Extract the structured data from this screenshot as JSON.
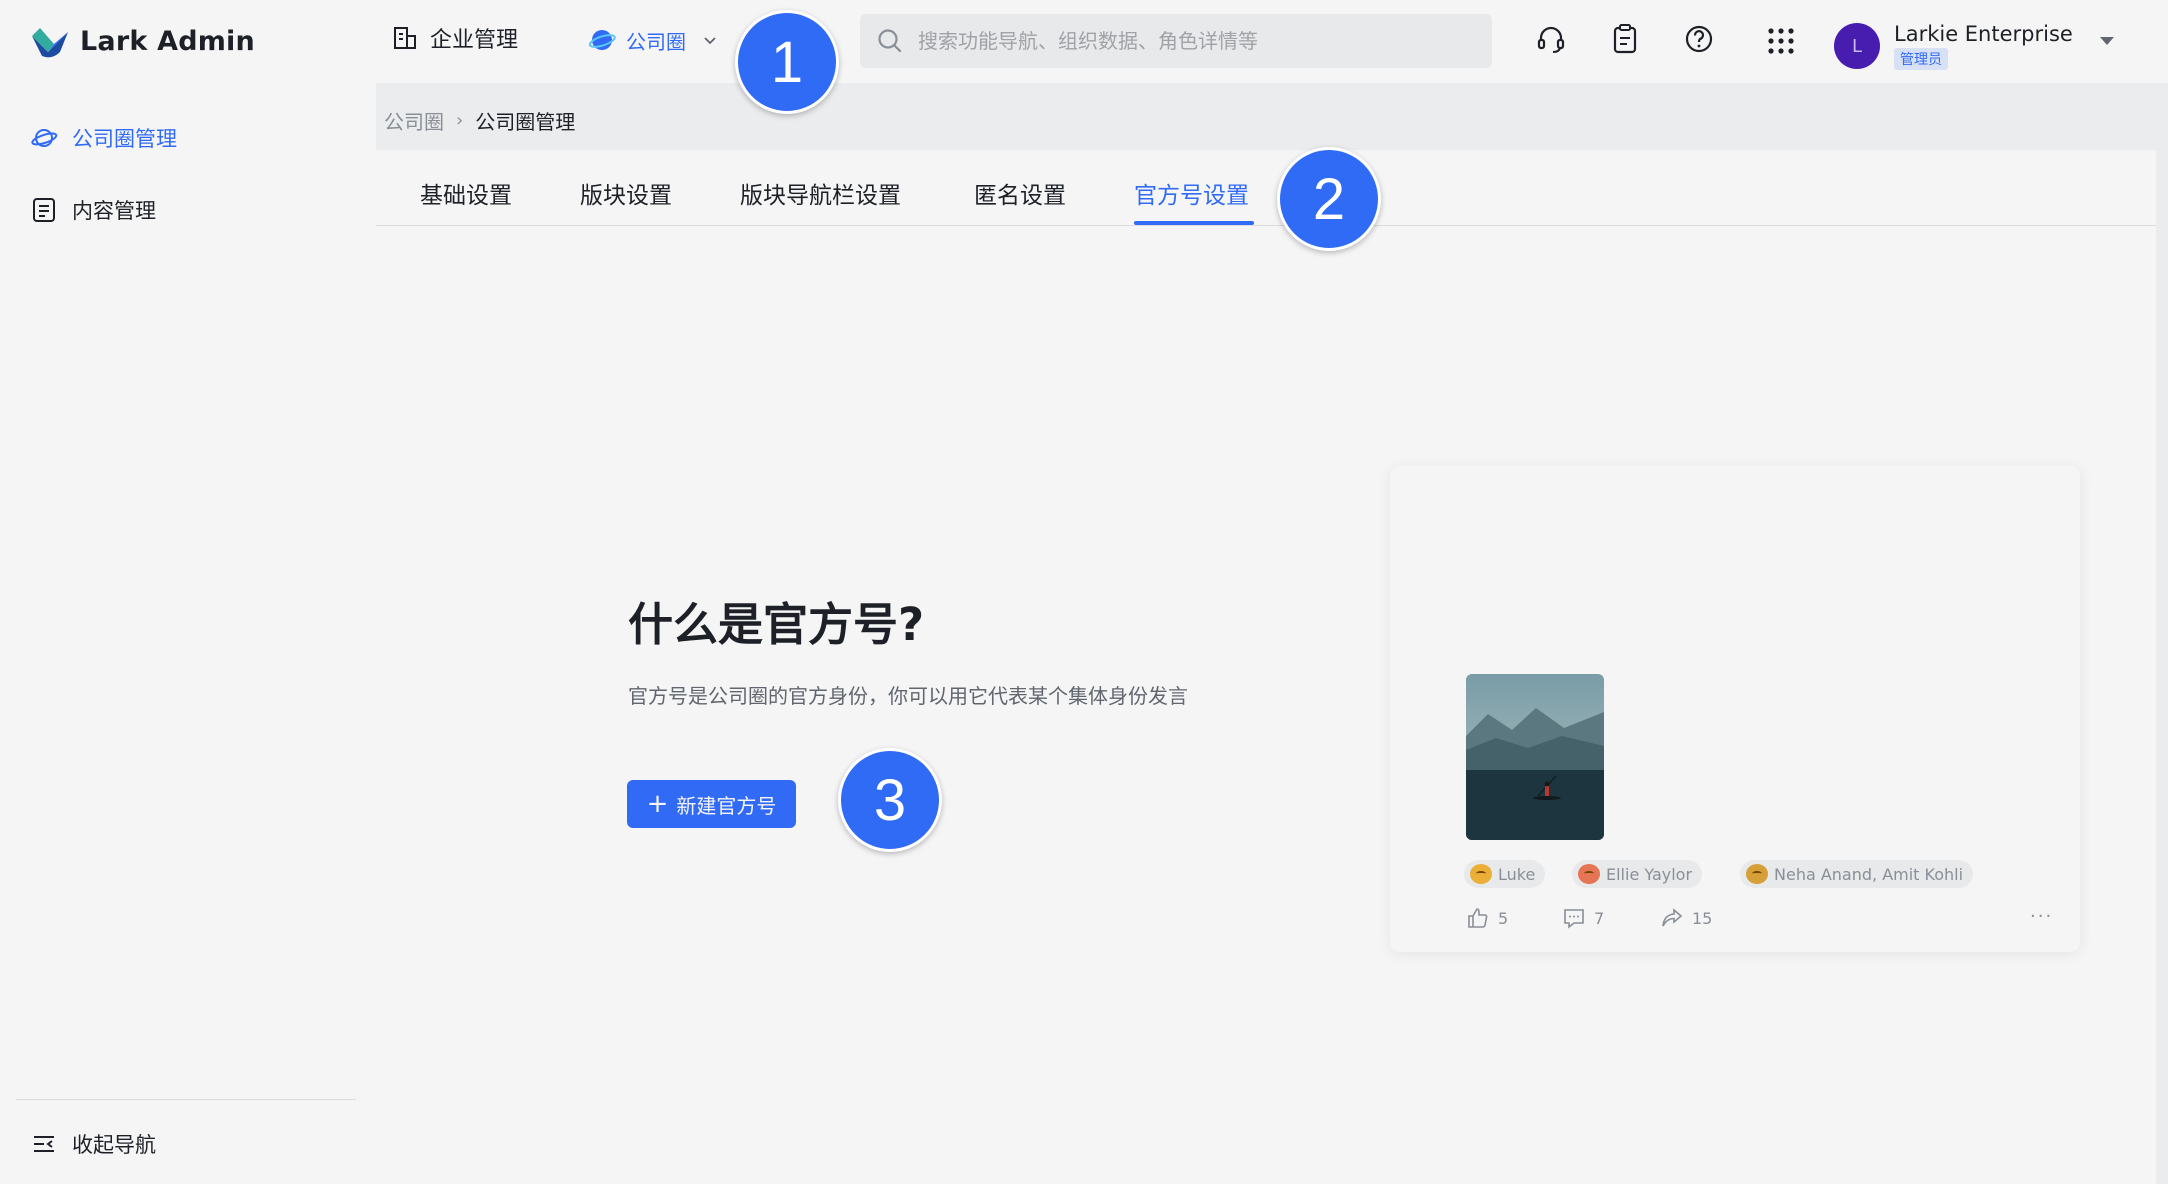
{
  "app": {
    "name": "Lark Admin"
  },
  "topbar": {
    "org_label": "企业管理",
    "product_label": "公司圈",
    "search_placeholder": "搜索功能导航、组织数据、角色详情等",
    "user_name": "Larkie Enterprise",
    "user_role": "管理员",
    "avatar_initial": "L"
  },
  "sidebar": {
    "items": [
      {
        "label": "公司圈管理",
        "active": true
      },
      {
        "label": "内容管理",
        "active": false
      }
    ],
    "collapse_label": "收起导航"
  },
  "breadcrumb": {
    "root": "公司圈",
    "separator": "›",
    "current": "公司圈管理"
  },
  "tabs": [
    {
      "label": "基础设置",
      "active": false
    },
    {
      "label": "版块设置",
      "active": false
    },
    {
      "label": "版块导航栏设置",
      "active": false
    },
    {
      "label": "匿名设置",
      "active": false
    },
    {
      "label": "官方号设置",
      "active": true
    }
  ],
  "hero": {
    "title": "什么是官方号?",
    "description": "官方号是公司圈的官方身份，你可以用它代表某个集体身份发言",
    "button_label": "新建官方号",
    "button_icon": "+"
  },
  "preview": {
    "reactions": [
      {
        "names": "Luke"
      },
      {
        "names": "Ellie Yaylor"
      },
      {
        "names": "Neha Anand, Amit Kohli"
      }
    ],
    "stats": {
      "likes": "5",
      "comments": "7",
      "shares": "15"
    },
    "more": "···"
  },
  "markers": [
    "1",
    "2",
    "3"
  ],
  "colors": {
    "accent": "#3370ff",
    "marker": "#2f6bf5",
    "avatar": "#4a1fb8"
  }
}
